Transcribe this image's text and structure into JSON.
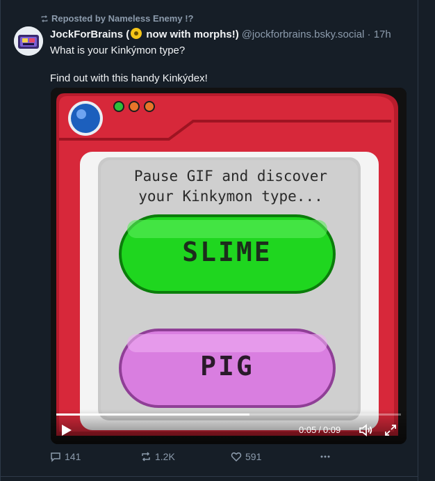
{
  "repost": {
    "label": "Reposted by Nameless Enemy !?",
    "icon": "repost-icon"
  },
  "post": {
    "display_name_part1": "JockForBrains (",
    "display_name_part2": " now with morphs!)",
    "badge_icon": "radiation-badge-icon",
    "handle": "@jockforbrains.bsky.social",
    "separator": "·",
    "timestamp": "17h",
    "text_line1": "What is your Kinkýmon type?",
    "text_line2": "Find out with this handy Kinkýdex!"
  },
  "media": {
    "screen_line1": "Pause GIF and discover",
    "screen_line2": "your Kinkymon type...",
    "option1": "SLIME",
    "option2": "PIG",
    "colors": {
      "frame_red": "#d7283a",
      "slime_green": "#1fd61f",
      "pig_pink": "#d97ee0"
    }
  },
  "video": {
    "current_time": "0:05",
    "total_time": "0:09",
    "time_separator": "/",
    "progress_fraction": 0.56,
    "play_icon": "play-icon",
    "volume_icon": "volume-icon",
    "fullscreen_icon": "fullscreen-icon"
  },
  "actions": {
    "replies": "141",
    "reposts": "1.2K",
    "likes": "591"
  }
}
